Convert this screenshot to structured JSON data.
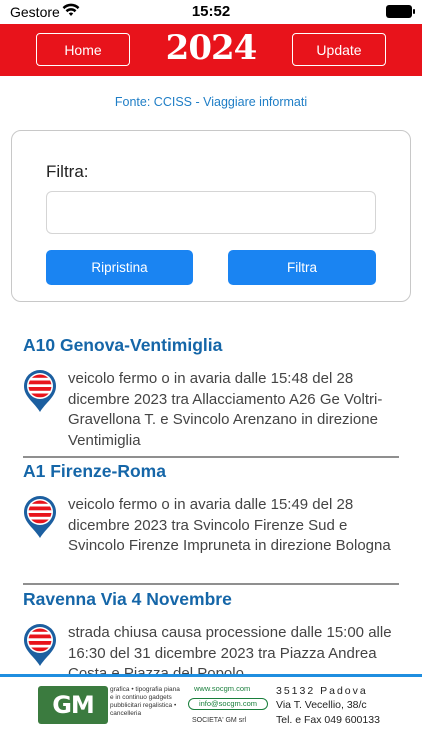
{
  "status_bar": {
    "carrier": "Gestore",
    "time": "15:52"
  },
  "header": {
    "home_label": "Home",
    "title": "2024",
    "update_label": "Update",
    "color": "#e8131b"
  },
  "source": "Fonte: CCISS - Viaggiare informati",
  "filter": {
    "label": "Filtra:",
    "value": "",
    "placeholder": "",
    "reset_label": "Ripristina",
    "filter_label": "Filtra"
  },
  "events": [
    {
      "road": "A10 Genova-Ventimiglia",
      "text": "veicolo fermo o in avaria dalle 15:48 del 28 dicembre 2023 tra Allacciamento A26 Ge Voltri-Gravellona T. e Svincolo Arenzano in direzione Ventimiglia"
    },
    {
      "road": "A1 Firenze-Roma",
      "text": "veicolo fermo o in avaria dalle 15:49 del 28 dicembre 2023 tra Svincolo Firenze Sud e Svincolo Firenze Impruneta in direzione Bologna"
    },
    {
      "road": "Ravenna Via 4 Novembre",
      "text": "strada chiusa causa processione dalle 15:00 alle 16:30 del 31 dicembre 2023 tra Piazza Andrea Costa e Piazza del Popolo"
    }
  ],
  "footer_ad": {
    "logo": "GM",
    "tags": "grafica • tipografia piana e in continuo gadgets pubblicitari regalistica • cancelleria",
    "web": "www.socgm.com",
    "email": "info@socgm.com",
    "company": "SOCIETA' GM srl",
    "address_line1": "35132 Padova",
    "address_line2": "Via T. Vecellio, 38/c",
    "address_line3": "Tel. e Fax 049 600133"
  }
}
